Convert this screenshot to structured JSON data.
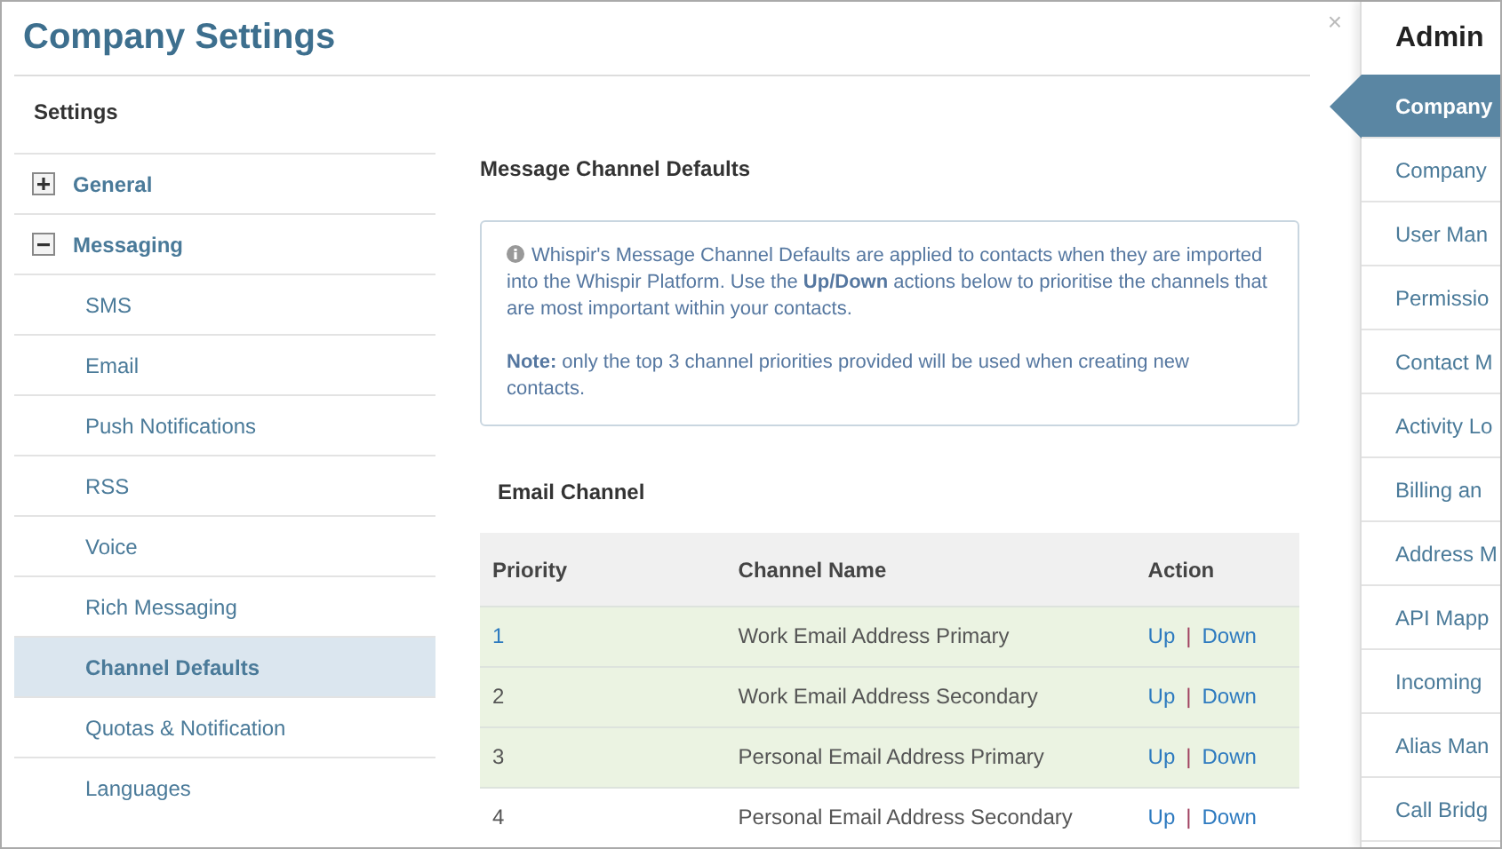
{
  "dialog": {
    "title": "Company Settings",
    "close": "×"
  },
  "settings_nav": {
    "heading": "Settings",
    "groups": [
      {
        "label": "General",
        "expanded": false
      },
      {
        "label": "Messaging",
        "expanded": true,
        "children": [
          {
            "label": "SMS",
            "selected": false
          },
          {
            "label": "Email",
            "selected": false
          },
          {
            "label": "Push Notifications",
            "selected": false
          },
          {
            "label": "RSS",
            "selected": false
          },
          {
            "label": "Voice",
            "selected": false
          },
          {
            "label": "Rich Messaging",
            "selected": false
          },
          {
            "label": "Channel Defaults",
            "selected": true
          },
          {
            "label": "Quotas & Notification",
            "selected": false
          },
          {
            "label": "Languages",
            "selected": false
          }
        ]
      }
    ]
  },
  "content": {
    "heading": "Message Channel Defaults",
    "info": "Whispir's Message Channel Defaults are applied to contacts when they are imported into the Whispir Platform. Use the **Up/Down** actions below to prioritise the channels that are most important within your contacts.",
    "note": "**Note:** only the top 3 channel priorities provided will be used when creating new contacts.",
    "section_title": "Email Channel",
    "table": {
      "columns": [
        "Priority",
        "Channel Name",
        "Action"
      ],
      "rows": [
        {
          "priority": "1",
          "name": "Work Email Address Primary",
          "up": "Up",
          "separator": "|",
          "down": "Down",
          "highlighted": true
        },
        {
          "priority": "2",
          "name": "Work Email Address Secondary",
          "up": "Up",
          "separator": "|",
          "down": "Down",
          "highlighted": true
        },
        {
          "priority": "3",
          "name": "Personal Email Address Primary",
          "up": "Up",
          "separator": "|",
          "down": "Down",
          "highlighted": true
        },
        {
          "priority": "4",
          "name": "Personal Email Address Secondary",
          "up": "Up",
          "separator": "|",
          "down": "Down",
          "highlighted": false
        }
      ]
    }
  },
  "admin_panel": {
    "title": "Admin",
    "items": [
      {
        "label": "Company",
        "selected": true
      },
      {
        "label": "Company",
        "selected": false
      },
      {
        "label": "User Man",
        "selected": false
      },
      {
        "label": "Permissio",
        "selected": false
      },
      {
        "label": "Contact M",
        "selected": false
      },
      {
        "label": "Activity Lo",
        "selected": false
      },
      {
        "label": "Billing an",
        "selected": false
      },
      {
        "label": "Address M",
        "selected": false
      },
      {
        "label": "API Mapp",
        "selected": false
      },
      {
        "label": "Incoming",
        "selected": false
      },
      {
        "label": "Alias Man",
        "selected": false
      },
      {
        "label": "Call Bridg",
        "selected": false
      }
    ]
  }
}
